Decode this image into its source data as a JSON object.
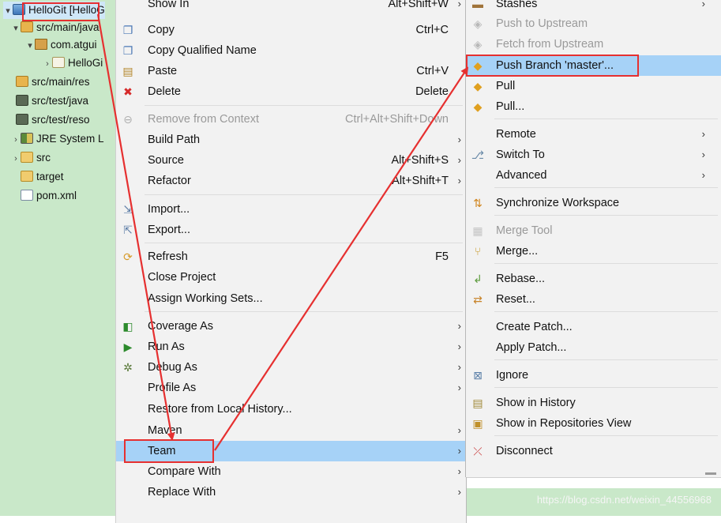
{
  "tree": {
    "items": [
      {
        "label": "HelloGit [HelloG",
        "twisty": "▾"
      },
      {
        "label": "src/main/java",
        "twisty": "▾"
      },
      {
        "label": "com.atgui",
        "twisty": "▾"
      },
      {
        "label": "HelloGi",
        "twisty": "›"
      },
      {
        "label": "src/main/res",
        "twisty": ""
      },
      {
        "label": "src/test/java",
        "twisty": ""
      },
      {
        "label": "src/test/reso",
        "twisty": ""
      },
      {
        "label": "JRE System L",
        "twisty": "›"
      },
      {
        "label": "src",
        "twisty": "›"
      },
      {
        "label": "target",
        "twisty": ""
      },
      {
        "label": "pom.xml",
        "twisty": ""
      }
    ]
  },
  "main_menu": {
    "items": [
      {
        "label": "Show In",
        "accel": "Alt+Shift+W",
        "submenu": "›"
      },
      {
        "label": "Copy",
        "accel": "Ctrl+C"
      },
      {
        "label": "Copy Qualified Name",
        "accel": ""
      },
      {
        "label": "Paste",
        "accel": "Ctrl+V"
      },
      {
        "label": "Delete",
        "accel": "Delete"
      },
      {
        "label": "Remove from Context",
        "accel": "Ctrl+Alt+Shift+Down"
      },
      {
        "label": "Build Path",
        "accel": "",
        "submenu": "›"
      },
      {
        "label": "Source",
        "accel": "Alt+Shift+S",
        "submenu": "›"
      },
      {
        "label": "Refactor",
        "accel": "Alt+Shift+T",
        "submenu": "›"
      },
      {
        "label": "Import...",
        "accel": ""
      },
      {
        "label": "Export...",
        "accel": ""
      },
      {
        "label": "Refresh",
        "accel": "F5"
      },
      {
        "label": "Close Project",
        "accel": ""
      },
      {
        "label": "Assign Working Sets...",
        "accel": ""
      },
      {
        "label": "Coverage As",
        "accel": "",
        "submenu": "›"
      },
      {
        "label": "Run As",
        "accel": "",
        "submenu": "›"
      },
      {
        "label": "Debug As",
        "accel": "",
        "submenu": "›"
      },
      {
        "label": "Profile As",
        "accel": "",
        "submenu": "›"
      },
      {
        "label": "Restore from Local History...",
        "accel": ""
      },
      {
        "label": "Maven",
        "accel": "",
        "submenu": "›"
      },
      {
        "label": "Team",
        "accel": "",
        "submenu": "›"
      },
      {
        "label": "Compare With",
        "accel": "",
        "submenu": "›"
      },
      {
        "label": "Replace With",
        "accel": "",
        "submenu": "›"
      }
    ]
  },
  "team_menu": {
    "items": [
      {
        "label": "Stashes",
        "submenu": "›"
      },
      {
        "label": "Push to Upstream"
      },
      {
        "label": "Fetch from Upstream"
      },
      {
        "label": "Push Branch 'master'..."
      },
      {
        "label": "Pull"
      },
      {
        "label": "Pull..."
      },
      {
        "label": "Remote",
        "submenu": "›"
      },
      {
        "label": "Switch To",
        "submenu": "›"
      },
      {
        "label": "Advanced",
        "submenu": "›"
      },
      {
        "label": "Synchronize Workspace"
      },
      {
        "label": "Merge Tool"
      },
      {
        "label": "Merge..."
      },
      {
        "label": "Rebase..."
      },
      {
        "label": "Reset..."
      },
      {
        "label": "Create Patch..."
      },
      {
        "label": "Apply Patch..."
      },
      {
        "label": "Ignore"
      },
      {
        "label": "Show in History"
      },
      {
        "label": "Show in Repositories View"
      },
      {
        "label": "Disconnect"
      }
    ]
  },
  "watermark": "https://blog.csdn.net/weixin_44556968",
  "colors": {
    "highlight_box": "#e63030",
    "selected_item": "#a6d2f7",
    "explorer_bg": "#c9e8c9",
    "menu_bg": "#f2f2f2"
  }
}
